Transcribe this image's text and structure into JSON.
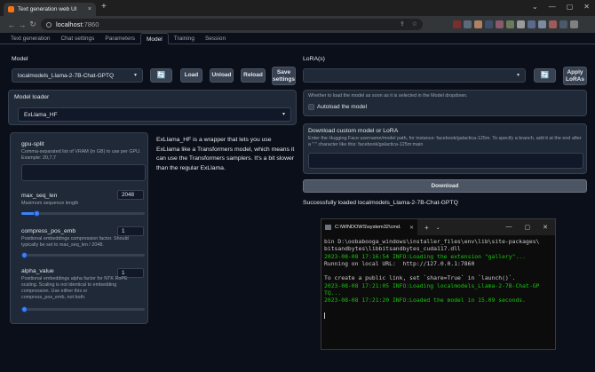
{
  "browser": {
    "tab_title": "Text generation web UI",
    "new_tab": "+",
    "close": "×",
    "address_host": "localhost",
    "address_port": ":7860",
    "window_controls": [
      "⌄",
      "—",
      "▢",
      "✕"
    ],
    "ext_colors": [
      "#7c2d2d",
      "#5b6b7a",
      "#b08060",
      "#3b4f6b",
      "#8a5a6a",
      "#6a7b5a",
      "#9a9a9a",
      "#5a6a8a",
      "#7a8aa0",
      "#a05a5a",
      "#4a5a6a",
      "#808080"
    ]
  },
  "tabs": [
    "Text generation",
    "Chat settings",
    "Parameters",
    "Model",
    "Training",
    "Session"
  ],
  "active_tab": "Model",
  "model": {
    "label": "Model",
    "selected": "localmodels_Llama-2-7B-Chat-GPTQ",
    "refresh_icon": "🔄",
    "load": "Load",
    "unload": "Unload",
    "reload": "Reload",
    "save_settings": "Save settings"
  },
  "lora": {
    "label": "LoRA(s)",
    "selected": "",
    "apply": "Apply LoRAs"
  },
  "loader": {
    "label": "Model loader",
    "selected": "ExLlama_HF",
    "description": "ExLlama_HF is a wrapper that lets you use ExLlama like a Transformers model, which means it can use the Transformers samplers. It's a bit slower than the regular ExLlama."
  },
  "params": {
    "gpu_split": {
      "label": "gpu-split",
      "info": "Comma-separated list of VRAM (in GB) to use per GPU. Example: 20,7,7"
    },
    "max_seq_len": {
      "label": "max_seq_len",
      "info": "Maximum sequence length",
      "value": "2048",
      "fraction": 0.12
    },
    "compress_pos_emb": {
      "label": "compress_pos_emb",
      "info": "Positional embeddings compression factor. Should typically be set to max_seq_len / 2048.",
      "value": "1",
      "fraction": 0.0
    },
    "alpha_value": {
      "label": "alpha_value",
      "info": "Positional embeddings alpha factor for NTK RoPE scaling. Scaling is not identical to embedding compression. Use either this or compress_pos_emb, not both.",
      "value": "1",
      "fraction": 0.0
    }
  },
  "autoload": {
    "info": "Whether to load the model as soon as it is selected in the Model dropdown.",
    "label": "Autoload the model"
  },
  "download": {
    "title": "Download custom model or LoRA",
    "info": "Enter the Hugging Face username/model path, for instance: facebook/galactica-125m. To specify a branch, add it at the end after a \":\" character like this: facebook/galactica-125m:main",
    "button": "Download"
  },
  "status": "Successfully loaded localmodels_Llama-2-7B-Chat-GPTQ",
  "terminal": {
    "title": "C:\\WINDOWS\\system32\\cmd.",
    "lines": [
      {
        "text": "bin D:\\oobabooga_windows\\installer_files\\env\\lib\\site-packages\\",
        "color": "w"
      },
      {
        "text": "bitsandbytes\\libbitsandbytes_cuda117.dll",
        "color": "w"
      },
      {
        "text": "2023-08-08 17:16:54 INFO:Loading the extension \"gallery\"...",
        "color": "g"
      },
      {
        "text": "Running on local URL:  http://127.0.0.1:7860",
        "color": "w"
      },
      {
        "text": "",
        "color": "w"
      },
      {
        "text": "To create a public link, set `share=True` in `launch()`.",
        "color": "w"
      },
      {
        "text": "2023-08-08 17:21:05 INFO:Loading localmodels_Llama-2-7B-Chat-GP",
        "color": "g"
      },
      {
        "text": "TQ...",
        "color": "g"
      },
      {
        "text": "2023-08-08 17:21:20 INFO:Loaded the model in 15.09 seconds.",
        "color": "g"
      }
    ]
  }
}
